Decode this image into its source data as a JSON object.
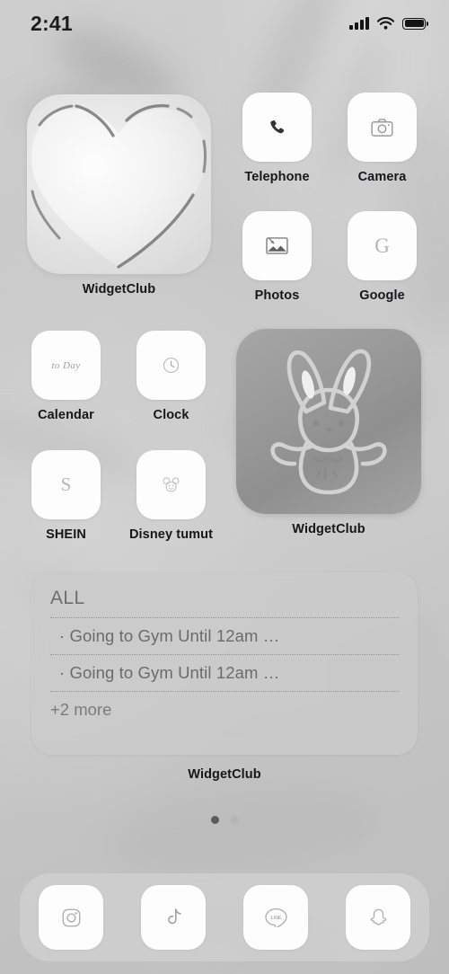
{
  "status_bar": {
    "time": "2:41",
    "signal_icon": "cellular-bars-icon",
    "wifi_icon": "wifi-icon",
    "battery_icon": "battery-full-icon"
  },
  "widgets": {
    "heart": {
      "label": "WidgetClub",
      "icon": "heart-3d-widget",
      "size": "medium"
    },
    "bunny": {
      "label": "WidgetClub",
      "icon": "bunny-outline-widget",
      "size": "medium"
    },
    "reminders": {
      "label": "WidgetClub",
      "list_title": "ALL",
      "items": [
        "· Going to Gym Until 12am …",
        "· Going to Gym Until 12am …"
      ],
      "more_text": "+2 more"
    }
  },
  "apps": [
    {
      "label": "Telephone",
      "icon": "phone-icon"
    },
    {
      "label": "Camera",
      "icon": "camera-icon"
    },
    {
      "label": "Photos",
      "icon": "photos-icon"
    },
    {
      "label": "Google",
      "icon": "google-g-icon"
    },
    {
      "label": "Calendar",
      "icon": "calendar-today-icon"
    },
    {
      "label": "Clock",
      "icon": "clock-icon"
    },
    {
      "label": "SHEIN",
      "icon": "shein-s-icon"
    },
    {
      "label": "Disney tumut",
      "icon": "disney-mouse-icon"
    }
  ],
  "calendar_icon_text": "to Day",
  "shein_icon_text": "S",
  "google_icon_text": "G",
  "page_dots": {
    "count": 2,
    "active_index": 0
  },
  "dock": [
    {
      "label": "Instagram",
      "icon": "instagram-icon"
    },
    {
      "label": "TikTok",
      "icon": "tiktok-icon"
    },
    {
      "label": "LINE",
      "icon": "line-icon"
    },
    {
      "label": "Snapchat",
      "icon": "snapchat-ghost-icon"
    }
  ],
  "colors": {
    "background": "#c8c8c8",
    "tile": "#fdfdfd",
    "label_text": "#17171a",
    "widget_bg": "#cacaca",
    "widget_text": "#6b6b6b",
    "bunny_widget_bg": "#9a9a9a",
    "dot_active": "#5c5c5c",
    "dot_inactive": "#b5b5b5"
  }
}
